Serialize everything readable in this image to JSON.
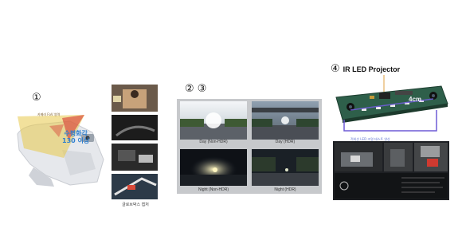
{
  "section1": {
    "number": "①",
    "fov_label_line1": "수평화각",
    "fov_label_line2": "130 이상",
    "top_note": "카메라 FoV 영역",
    "side_caption": "글로브박스 캡처"
  },
  "section23": {
    "numbers": "② ③",
    "photos": [
      {
        "caption": "Day (Non-HDR)"
      },
      {
        "caption": "Day (HDR)"
      },
      {
        "caption": "Night (Non-HDR)"
      },
      {
        "caption": "Night (HDR)"
      }
    ]
  },
  "section4": {
    "number": "④",
    "title": "IR LED Projector",
    "dimension": "4cm",
    "lower_note": "적외선 LED 조명 테스트 영상"
  },
  "colors": {
    "fov_yellow": "#e8c84a",
    "fov_red": "#d8433a",
    "fov_text_blue": "#2e7fd0",
    "dimension_purple": "#6f5cd6",
    "pcb_green": "#2e5f4a"
  }
}
